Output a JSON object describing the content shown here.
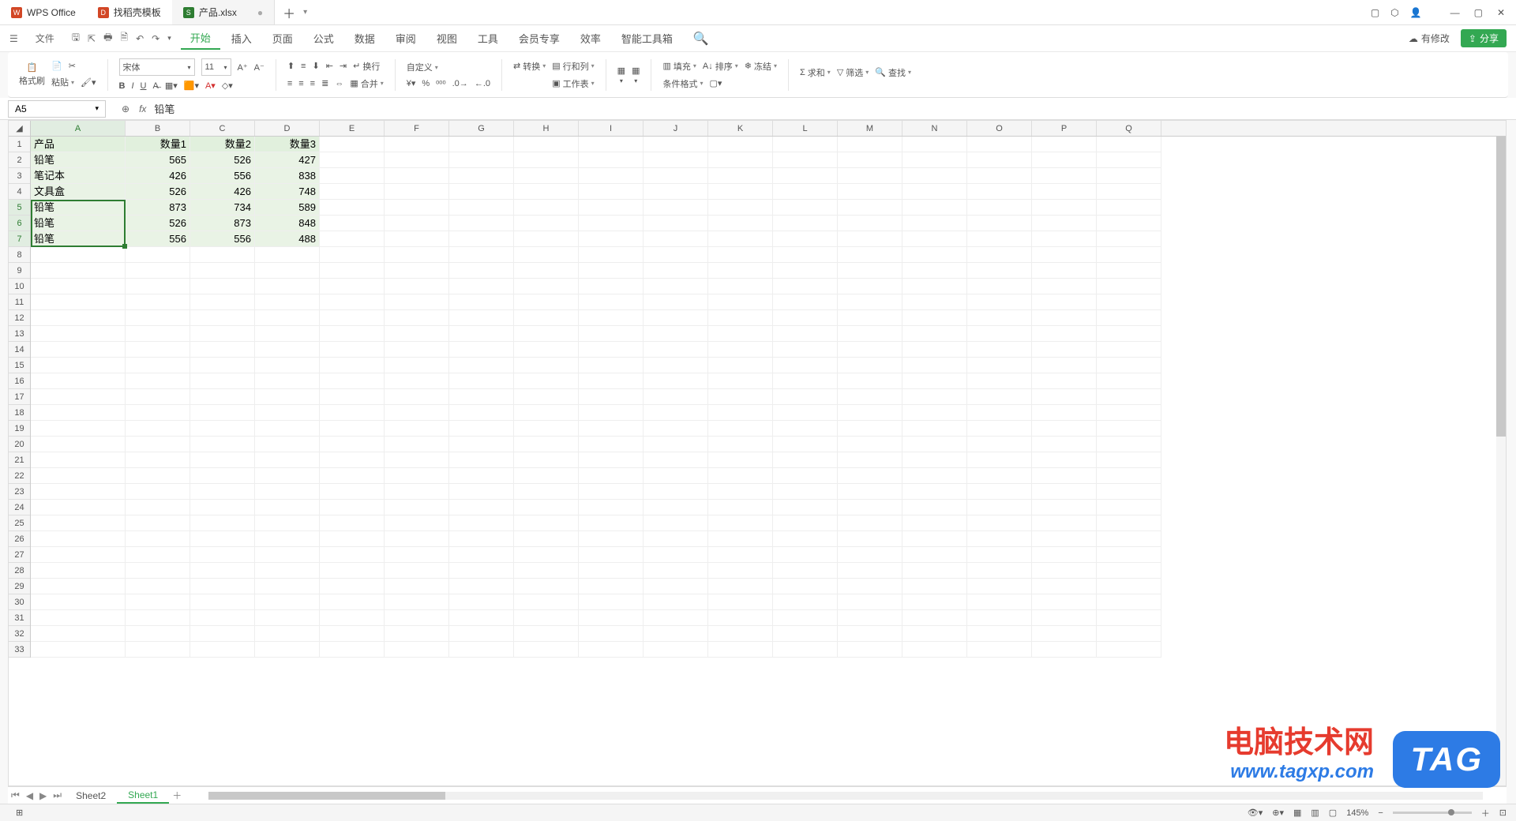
{
  "titlebar": {
    "app": "WPS Office",
    "template_tab": "找稻壳模板",
    "doc_tab": "产品.xlsx"
  },
  "menu": {
    "file": "文件",
    "items": [
      "开始",
      "插入",
      "页面",
      "公式",
      "数据",
      "审阅",
      "视图",
      "工具",
      "会员专享",
      "效率",
      "智能工具箱"
    ],
    "active": "开始",
    "cloud": "有修改",
    "share": "分享"
  },
  "ribbon": {
    "format_painter": "格式刷",
    "paste": "粘贴",
    "font": "宋体",
    "size": "11",
    "wrap": "换行",
    "merge": "合并",
    "custom": "自定义",
    "convert": "转换",
    "rowcol": "行和列",
    "worksheet": "工作表",
    "cond_format": "条件格式",
    "fill": "填充",
    "sort": "排序",
    "freeze": "冻结",
    "sum": "求和",
    "filter": "筛选",
    "find": "查找"
  },
  "namebox": "A5",
  "formula": "铅笔",
  "columns": [
    "A",
    "B",
    "C",
    "D",
    "E",
    "F",
    "G",
    "H",
    "I",
    "J",
    "K",
    "L",
    "M",
    "N",
    "O",
    "P",
    "Q"
  ],
  "headers": [
    "产品",
    "数量1",
    "数量2",
    "数量3"
  ],
  "data": [
    [
      "铅笔",
      565,
      526,
      427
    ],
    [
      "笔记本",
      426,
      556,
      838
    ],
    [
      "文具盒",
      526,
      426,
      748
    ],
    [
      "铅笔",
      873,
      734,
      589
    ],
    [
      "铅笔",
      526,
      873,
      848
    ],
    [
      "铅笔",
      556,
      556,
      488
    ]
  ],
  "sheets": {
    "list": [
      "Sheet2",
      "Sheet1"
    ],
    "active": "Sheet1"
  },
  "zoom": "145%",
  "watermark": {
    "line1": "电脑技术网",
    "line2": "www.tagxp.com",
    "badge": "TAG"
  }
}
